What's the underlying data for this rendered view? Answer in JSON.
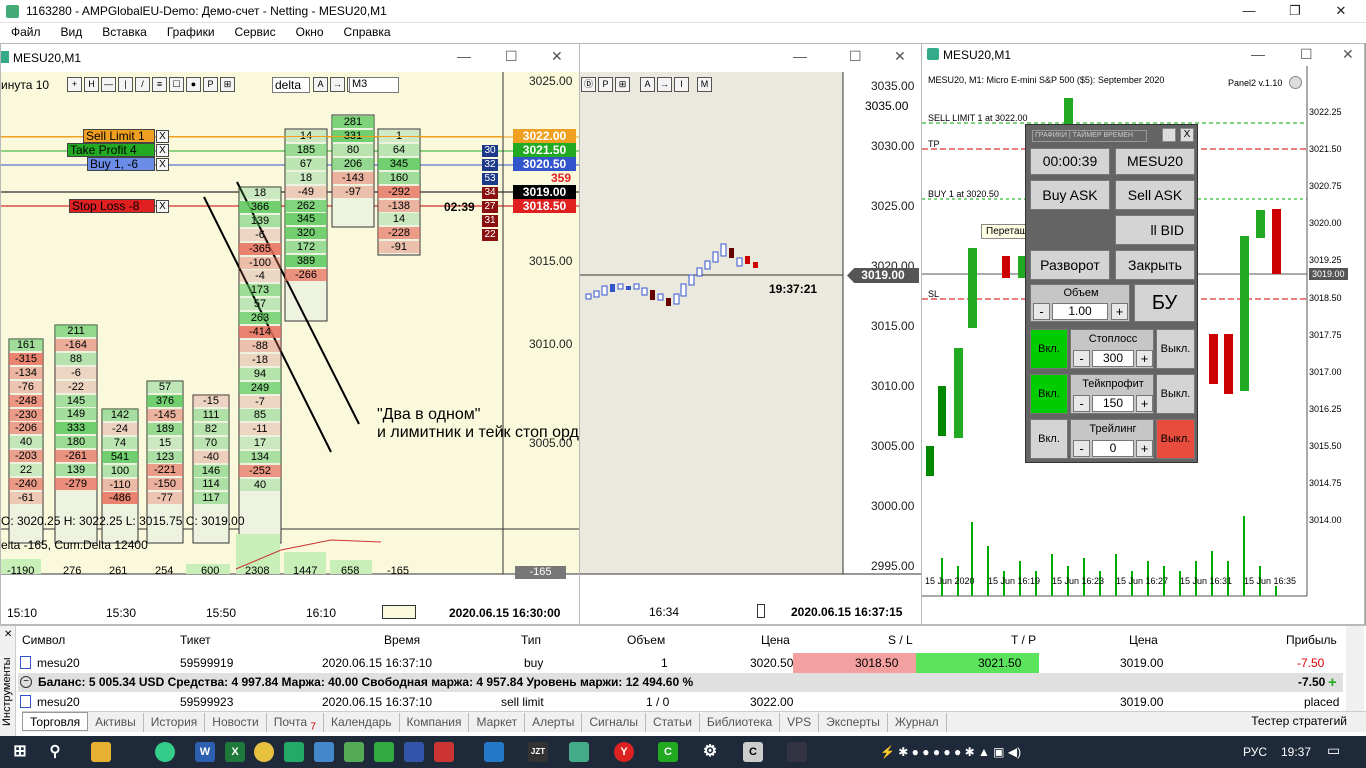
{
  "app": {
    "title": "1163280 - AMPGlobalEU-Demo: Демо-счет - Netting - MESU20,M1",
    "menu": [
      "Файл",
      "Вид",
      "Вставка",
      "Графики",
      "Сервис",
      "Окно",
      "Справка"
    ]
  },
  "win1": {
    "title": "MESU20,M1",
    "toolbar_label": "инута  10",
    "delta_select": "delta",
    "m3": "M3",
    "prices": [
      "3025.00",
      "3020.00",
      "3015.00",
      "3010.00",
      "3005.00"
    ],
    "tags": {
      "sell_limit": "3022.00",
      "tp": "3021.50",
      "buy": "3020.50",
      "current": "3019.00",
      "sl": "3018.50",
      "red_small": "359"
    },
    "timer": "02:39",
    "vol_tags": [
      "30",
      "32",
      "53",
      "34",
      "27",
      "31",
      "22"
    ],
    "orders": {
      "sell_limit": "Sell Limit  1",
      "take_profit": "Take Profit  4",
      "buy": "Buy  1,  -6",
      "stop_loss": "Stop Loss  -8",
      "x": "X"
    },
    "ohlc": "O: 3020.25  H: 3022.25  L: 3015.75  C: 3019.00",
    "delta_info": "elta -165, Cum.Delta 12400",
    "delta_bars": [
      "-1190",
      "276",
      "261",
      "254",
      "600",
      "2308",
      "1447",
      "658",
      "-165"
    ],
    "delta_tag": "-165",
    "times": [
      "15:10",
      "15:30",
      "15:50",
      "16:10"
    ],
    "datetime": "2020.06.15 16:30:00",
    "annotation1": "\"Два в одном\"",
    "annotation2": "и лимитник и тейк стоп ордером одновременно",
    "col1": [
      "161",
      "-315",
      "-134",
      "-76",
      "-248",
      "-230",
      "-206",
      "40",
      "-203",
      "22",
      "-240",
      "-61"
    ],
    "col2": [
      "211",
      "-164",
      "88",
      "-6",
      "-22",
      "145",
      "149",
      "333",
      "180",
      "-261",
      "139",
      "-279"
    ],
    "col3": [
      "142",
      "-24",
      "74",
      "541",
      "100",
      "-110",
      "-486"
    ],
    "col4": [
      "57",
      "376",
      "-145",
      "189",
      "15",
      "123",
      "-221",
      "-150",
      "-77"
    ],
    "col5": [
      "-15",
      "111",
      "82",
      "70",
      "-40",
      "146",
      "114",
      "117"
    ],
    "col6": [
      "18",
      "366",
      "139",
      "-6",
      "-365",
      "-100",
      "-4",
      "173",
      "57",
      "263",
      "-414",
      "-88",
      "-18",
      "94",
      "249",
      "-7",
      "85",
      "-11",
      "17",
      "134",
      "-252",
      "40"
    ],
    "col7": [
      "14",
      "185",
      "67",
      "18",
      "-49",
      "262",
      "345",
      "320",
      "172",
      "389",
      "-266"
    ],
    "col8": [
      "281",
      "331",
      "80",
      "206",
      "-143",
      "-97"
    ],
    "col9": [
      "1",
      "64",
      "345",
      "160",
      "-292",
      "-138",
      "14",
      "-228",
      "-91"
    ]
  },
  "win2": {
    "prices": [
      "3035.00",
      "3030.00",
      "3025.00",
      "3020.00",
      "3015.00",
      "3010.00",
      "3005.00",
      "3000.00",
      "2995.00"
    ],
    "current_tag": "3019.00",
    "clock": "19:37:21",
    "time": "16:34",
    "datetime": "2020.06.15 16:37:15"
  },
  "win3": {
    "title": "MESU20,M1",
    "header": "MESU20, M1:  Micro E-mini S&P 500 ($5): September 2020",
    "panel_ver": "Panel2 v.1.10",
    "lines": {
      "sell_limit": "SELL LIMIT  1 at 3022.00",
      "tp": "TP",
      "buy": "BUY  1 at 3020.50",
      "sl": "SL"
    },
    "prices": [
      "3022.25",
      "3021.50",
      "3020.75",
      "3020.00",
      "3019.25",
      "3019.00",
      "3018.50",
      "3017.75",
      "3017.00",
      "3016.25",
      "3015.50",
      "3014.75",
      "3014.00"
    ],
    "times": [
      "15 Jun 2020",
      "15 Jun 16:19",
      "15 Jun 16:23",
      "15 Jun 16:27",
      "15 Jun 16:31",
      "15 Jun 16:35"
    ],
    "tooltip": "Перетащите для изменения"
  },
  "panel": {
    "tabs": "ГРАФИКИ | ТАЙМЕР ВРЕМЕН",
    "close": "X",
    "timer": "00:00:39",
    "symbol": "MESU20",
    "buy_ask": "Buy ASK",
    "sell_ask": "Sell ASK",
    "sell_bid": "ll BID",
    "reverse": "Разворот",
    "close_pos": "Закрыть",
    "volume_label": "Объем",
    "volume": "1.00",
    "bu": "БУ",
    "stoploss_label": "Стоплосс",
    "stoploss": "300",
    "tp_label": "Тейкпрофит",
    "tp": "150",
    "trail_label": "Трейлинг",
    "trail": "0",
    "on": "Вкл.",
    "off": "Выкл.",
    "minus": "-",
    "plus": "+"
  },
  "table": {
    "headers": [
      "Символ",
      "Тикет",
      "Время",
      "Тип",
      "Объем",
      "Цена",
      "S / L",
      "T / P",
      "Цена",
      "Прибыль"
    ],
    "row1": [
      "mesu20",
      "59599919",
      "2020.06.15 16:37:10",
      "buy",
      "1",
      "3020.50",
      "3018.50",
      "3021.50",
      "3019.00",
      "-7.50"
    ],
    "balance": "Баланс: 5 005.34 USD  Средства: 4 997.84  Маржа: 40.00  Свободная маржа: 4 957.84  Уровень маржи: 12 494.60 %",
    "balance_profit": "-7.50",
    "row2": [
      "mesu20",
      "59599923",
      "2020.06.15 16:37:10",
      "sell limit",
      "1 / 0",
      "3022.00",
      "",
      "",
      "3019.00",
      "placed"
    ],
    "side_label": "Инструменты"
  },
  "tabs": [
    "Торговля",
    "Активы",
    "История",
    "Новости",
    "Почта",
    "Календарь",
    "Компания",
    "Маркет",
    "Алерты",
    "Сигналы",
    "Статьи",
    "Библиотека",
    "VPS",
    "Эксперты",
    "Журнал"
  ],
  "mail_count": "7",
  "tester": "Тестер стратегий",
  "taskbar": {
    "lang": "РУС",
    "time": "19:37",
    "jzt": "JZT"
  }
}
